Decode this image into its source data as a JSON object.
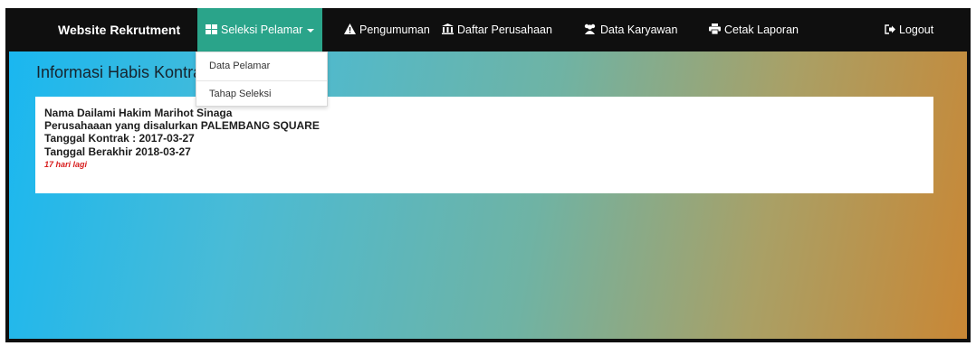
{
  "navbar": {
    "brand": "Website Rekrutment",
    "items": [
      {
        "label": "Seleksi Pelamar",
        "icon": "th-large-icon",
        "active": true
      },
      {
        "label": "Pengumuman",
        "icon": "warning-icon"
      },
      {
        "label": "Daftar Perusahaan",
        "icon": "bank-icon"
      },
      {
        "label": "Data Karyawan",
        "icon": "users-icon"
      },
      {
        "label": "Cetak Laporan",
        "icon": "print-icon"
      }
    ],
    "logout": {
      "label": "Logout",
      "icon": "sign-out-icon"
    }
  },
  "dropdown": {
    "items": [
      {
        "label": "Data Pelamar"
      },
      {
        "label": "Tahap Seleksi"
      }
    ]
  },
  "main": {
    "title": "Informasi Habis Kontrak Karyawan",
    "card": {
      "nama": "Nama Dailami Hakim Marihot Sinaga",
      "perusahaan": "Perusahaaan yang disalurkan PALEMBANG SQUARE",
      "tanggal_kontrak": "Tanggal Kontrak : 2017-03-27",
      "tanggal_berakhir": "Tanggal Berakhir 2018-03-27",
      "sisa": "17 hari lagi"
    }
  },
  "colors": {
    "navbar_bg": "#0f0f0f",
    "active_item": "#2aa48a",
    "gradient_start": "#1ab7f0",
    "gradient_end": "#c98735",
    "remaining_text": "#d81d1d"
  }
}
